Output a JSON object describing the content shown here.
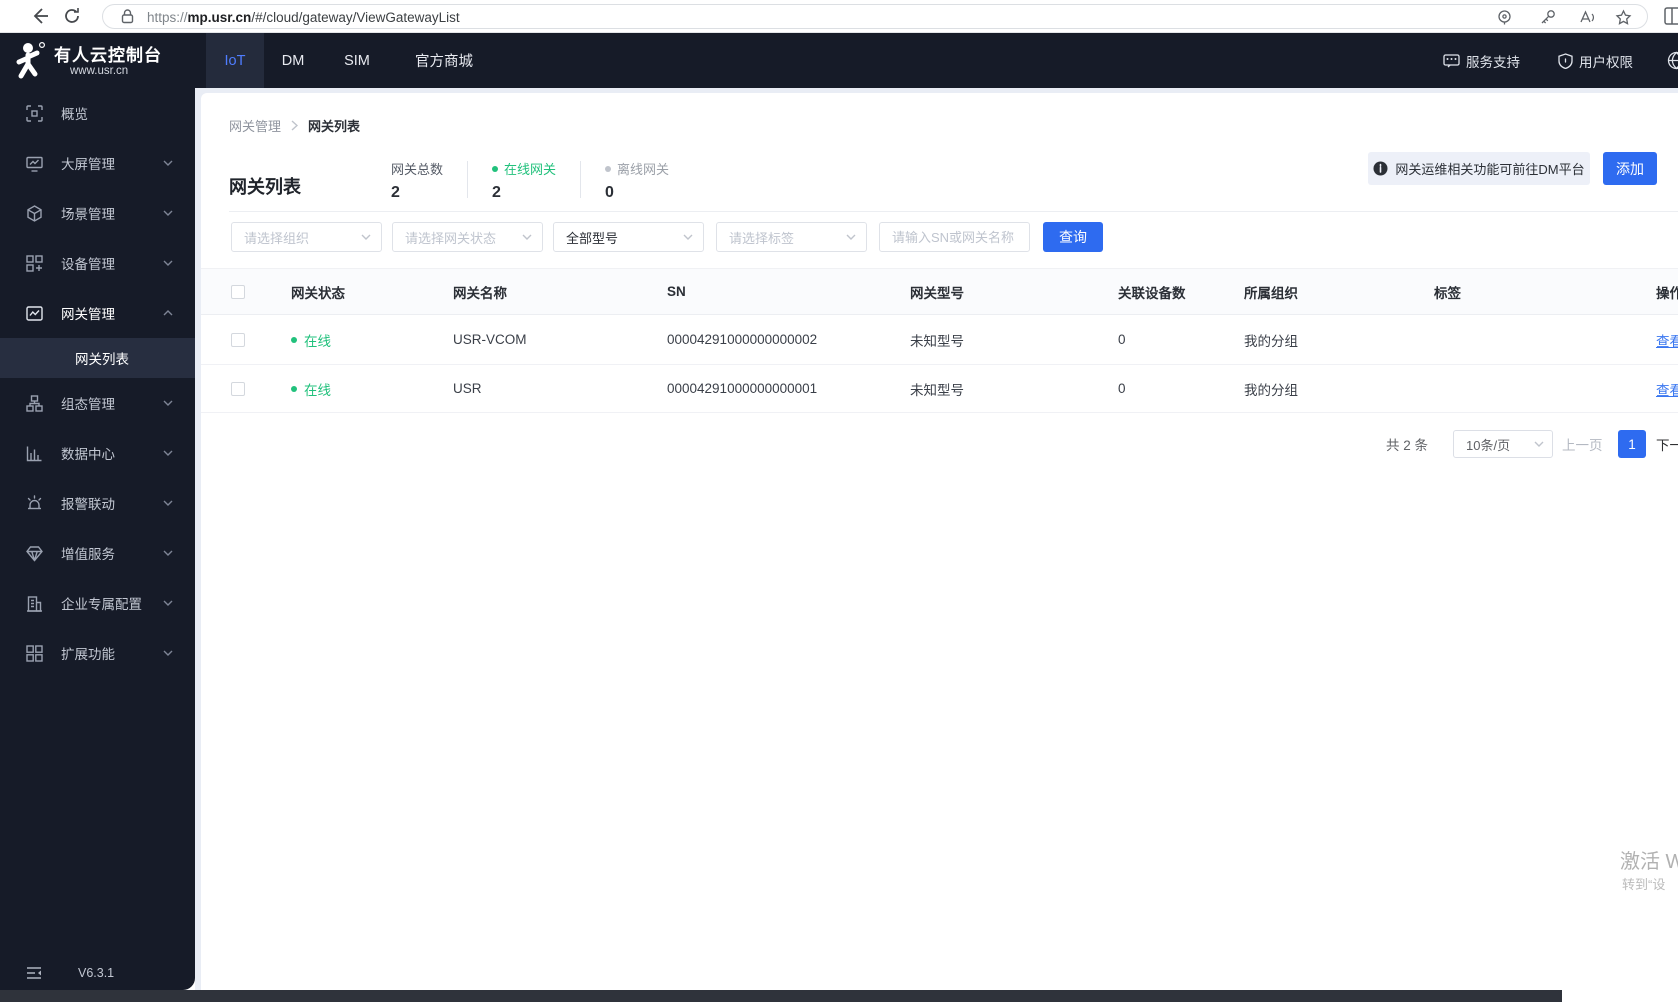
{
  "browser": {
    "url_scheme": "https://",
    "url_host": "mp.usr.cn",
    "url_path": "/#/cloud/gateway/ViewGatewayList"
  },
  "header": {
    "logo_title": "有人云控制台",
    "logo_subtitle": "www.usr.cn",
    "tabs": [
      {
        "label": "IoT"
      },
      {
        "label": "DM"
      },
      {
        "label": "SIM"
      },
      {
        "label": "官方商城"
      }
    ],
    "support_label": "服务支持",
    "permission_label": "用户权限"
  },
  "sidebar": {
    "items": [
      {
        "label": "概览"
      },
      {
        "label": "大屏管理"
      },
      {
        "label": "场景管理"
      },
      {
        "label": "设备管理"
      },
      {
        "label": "网关管理"
      },
      {
        "label": "组态管理"
      },
      {
        "label": "数据中心"
      },
      {
        "label": "报警联动"
      },
      {
        "label": "增值服务"
      },
      {
        "label": "企业专属配置"
      },
      {
        "label": "扩展功能"
      }
    ],
    "submenu_active": "网关列表",
    "version": "V6.3.1"
  },
  "breadcrumb": [
    "网关管理",
    "网关列表"
  ],
  "page": {
    "title": "网关列表",
    "stats": [
      {
        "label": "网关总数",
        "value": "2"
      },
      {
        "label": "在线网关",
        "value": "2"
      },
      {
        "label": "离线网关",
        "value": "0"
      }
    ],
    "notice": "网关运维相关功能可前往DM平台",
    "add_button": "添加"
  },
  "filters": {
    "org_placeholder": "请选择组织",
    "status_placeholder": "请选择网关状态",
    "model_value": "全部型号",
    "tag_placeholder": "请选择标签",
    "search_placeholder": "请输入SN或网关名称",
    "query_button": "查询"
  },
  "table": {
    "columns": [
      "网关状态",
      "网关名称",
      "SN",
      "网关型号",
      "关联设备数",
      "所属组织",
      "标签",
      "操作"
    ],
    "rows": [
      {
        "status": "在线",
        "name": "USR-VCOM",
        "sn": "00004291000000000002",
        "model": "未知型号",
        "devices": "0",
        "org": "我的分组",
        "tag": "",
        "action": "查看"
      },
      {
        "status": "在线",
        "name": "USR",
        "sn": "00004291000000000001",
        "model": "未知型号",
        "devices": "0",
        "org": "我的分组",
        "tag": "",
        "action": "查看"
      }
    ]
  },
  "pagination": {
    "total": "共 2 条",
    "page_size": "10条/页",
    "prev": "上一页",
    "current": "1",
    "next": "下一页"
  },
  "watermark": {
    "line1": "激活 W",
    "line2": "转到“设"
  },
  "colors": {
    "accent_blue": "#2e6bf0",
    "online_green": "#21c17c",
    "dark_navy": "#161b28"
  }
}
